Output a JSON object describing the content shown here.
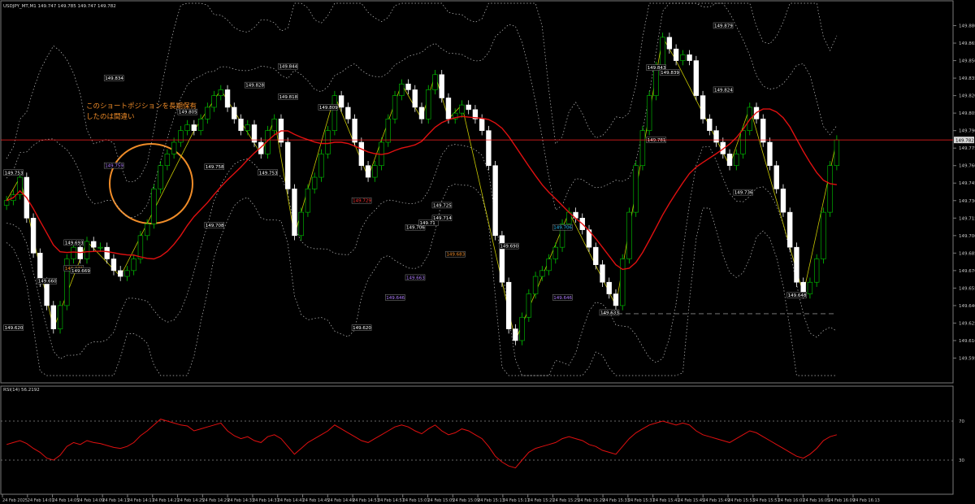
{
  "header": {
    "symbol_line": "USDJPY_MT,M1  149.747 149.785 149.747 149.782"
  },
  "annotation": {
    "line1": "このショートポジションを長期保有",
    "line2": "したのは間違い"
  },
  "colors": {
    "background": "#000000",
    "bull_candle": "#00c800",
    "bear_candle": "#ffffff",
    "ma": "#e01010",
    "bands": "#bfbfbf",
    "zigzag": "#c8c800",
    "rsi": "#e01010",
    "circle": "#f08c28",
    "annotation_text": "#f08c28",
    "price_line": "#ff2020"
  },
  "chart_data": {
    "type": "candlestick",
    "instrument": "USDJPY_MT",
    "timeframe": "M1",
    "ohlc_header": {
      "open": 149.747,
      "high": 149.785,
      "low": 149.747,
      "close": 149.782
    },
    "ylim": [
      149.58,
      149.895
    ],
    "y_ticks": [
      "149.880",
      "149.865",
      "149.850",
      "149.835",
      "149.820",
      "149.805",
      "149.790",
      "149.775",
      "149.760",
      "149.745",
      "149.730",
      "149.715",
      "149.700",
      "149.685",
      "149.670",
      "149.655",
      "149.640",
      "149.625",
      "149.610",
      "149.595"
    ],
    "current_price": "149.782",
    "x_ticks": [
      "24 Feb 2025",
      "24 Feb 14:01",
      "24 Feb 14:05",
      "24 Feb 14:09",
      "24 Feb 14:13",
      "24 Feb 14:17",
      "24 Feb 14:21",
      "24 Feb 14:25",
      "24 Feb 14:29",
      "24 Feb 14:33",
      "24 Feb 14:37",
      "24 Feb 14:41",
      "24 Feb 14:45",
      "24 Feb 14:49",
      "24 Feb 14:53",
      "24 Feb 14:57",
      "24 Feb 15:01",
      "24 Feb 15:05",
      "24 Feb 15:09",
      "24 Feb 15:13",
      "24 Feb 15:17",
      "24 Feb 15:21",
      "24 Feb 15:25",
      "24 Feb 15:29",
      "24 Feb 15:33",
      "24 Feb 15:37",
      "24 Feb 15:41",
      "24 Feb 15:45",
      "24 Feb 15:49",
      "24 Feb 15:53",
      "24 Feb 15:57",
      "24 Feb 16:01",
      "24 Feb 16:05",
      "24 Feb 16:09",
      "24 Feb 16:13"
    ],
    "closes": [
      149.73,
      149.735,
      149.75,
      149.715,
      149.685,
      149.66,
      149.64,
      149.62,
      149.64,
      149.68,
      149.69,
      149.68,
      149.695,
      149.69,
      149.69,
      149.68,
      149.67,
      149.665,
      149.67,
      149.68,
      149.7,
      149.71,
      149.74,
      149.76,
      149.77,
      149.78,
      149.79,
      149.795,
      149.79,
      149.8,
      149.81,
      149.82,
      149.825,
      149.81,
      149.8,
      149.79,
      149.795,
      149.78,
      149.77,
      149.79,
      149.8,
      149.78,
      149.74,
      149.7,
      149.72,
      149.74,
      149.75,
      149.77,
      149.79,
      149.82,
      149.81,
      149.8,
      149.78,
      149.76,
      149.75,
      149.76,
      149.78,
      149.8,
      149.82,
      149.83,
      149.825,
      149.81,
      149.8,
      149.825,
      149.838,
      149.818,
      149.8,
      149.805,
      149.812,
      149.808,
      149.8,
      149.79,
      149.76,
      149.7,
      149.66,
      149.62,
      149.61,
      149.63,
      149.65,
      149.665,
      149.67,
      149.68,
      149.69,
      149.71,
      149.72,
      149.715,
      149.705,
      149.69,
      149.675,
      149.66,
      149.65,
      149.64,
      149.68,
      149.72,
      149.76,
      149.79,
      149.82,
      149.845,
      149.87,
      149.86,
      149.85,
      149.855,
      149.85,
      149.82,
      149.8,
      149.79,
      149.78,
      149.77,
      149.76,
      149.77,
      149.79,
      149.81,
      149.8,
      149.78,
      149.76,
      149.74,
      149.72,
      149.69,
      149.66,
      149.65,
      149.66,
      149.68,
      149.72,
      149.76,
      149.782
    ],
    "price_labels": [
      {
        "text": "149.753",
        "kind": "white"
      },
      {
        "text": "149.620",
        "kind": "white"
      },
      {
        "text": "149.660",
        "kind": "white"
      },
      {
        "text": "149.671",
        "kind": "orange"
      },
      {
        "text": "149.693",
        "kind": "white"
      },
      {
        "text": "149.669",
        "kind": "white"
      },
      {
        "text": "149.759",
        "kind": "purple"
      },
      {
        "text": "149.834",
        "kind": "white"
      },
      {
        "text": "149.805",
        "kind": "white"
      },
      {
        "text": "149.758",
        "kind": "white"
      },
      {
        "text": "149.708",
        "kind": "white"
      },
      {
        "text": "149.828",
        "kind": "white"
      },
      {
        "text": "149.753",
        "kind": "white"
      },
      {
        "text": "149.844",
        "kind": "white"
      },
      {
        "text": "149.818",
        "kind": "white"
      },
      {
        "text": "149.809",
        "kind": "white"
      },
      {
        "text": "149.729",
        "kind": "red"
      },
      {
        "text": "149.620",
        "kind": "white"
      },
      {
        "text": "149.646",
        "kind": "purple"
      },
      {
        "text": "149.663",
        "kind": "purple"
      },
      {
        "text": "149.706",
        "kind": "white"
      },
      {
        "text": "149.71",
        "kind": "white"
      },
      {
        "text": "149.714",
        "kind": "white"
      },
      {
        "text": "149.725",
        "kind": "white"
      },
      {
        "text": "149.683",
        "kind": "orange"
      },
      {
        "text": "149.690",
        "kind": "white"
      },
      {
        "text": "149.706",
        "kind": "cyan"
      },
      {
        "text": "149.646",
        "kind": "purple"
      },
      {
        "text": "149.633",
        "kind": "white"
      },
      {
        "text": "149.781",
        "kind": "white"
      },
      {
        "text": "149.843",
        "kind": "white"
      },
      {
        "text": "149.839",
        "kind": "white"
      },
      {
        "text": "149.879",
        "kind": "white"
      },
      {
        "text": "149.824",
        "kind": "white"
      },
      {
        "text": "149.736",
        "kind": "white"
      },
      {
        "text": "149.648",
        "kind": "white"
      }
    ],
    "rsi": {
      "label": "RSI(14) 56.2192",
      "levels": [
        70,
        30
      ],
      "values": [
        46,
        48,
        50,
        47,
        42,
        38,
        32,
        30,
        35,
        44,
        48,
        46,
        50,
        48,
        47,
        45,
        43,
        42,
        44,
        48,
        55,
        60,
        66,
        72,
        70,
        68,
        66,
        65,
        60,
        62,
        64,
        66,
        68,
        60,
        55,
        52,
        54,
        50,
        48,
        54,
        56,
        52,
        44,
        36,
        42,
        48,
        52,
        56,
        60,
        66,
        62,
        58,
        54,
        50,
        48,
        52,
        56,
        60,
        64,
        66,
        64,
        60,
        57,
        62,
        66,
        60,
        56,
        58,
        62,
        60,
        56,
        52,
        44,
        34,
        28,
        24,
        22,
        30,
        38,
        42,
        44,
        46,
        48,
        52,
        54,
        52,
        50,
        46,
        44,
        40,
        38,
        36,
        44,
        52,
        58,
        62,
        66,
        68,
        70,
        68,
        66,
        68,
        66,
        60,
        56,
        54,
        52,
        50,
        48,
        52,
        56,
        60,
        58,
        54,
        50,
        46,
        42,
        38,
        34,
        32,
        36,
        42,
        50,
        54,
        56
      ]
    }
  }
}
